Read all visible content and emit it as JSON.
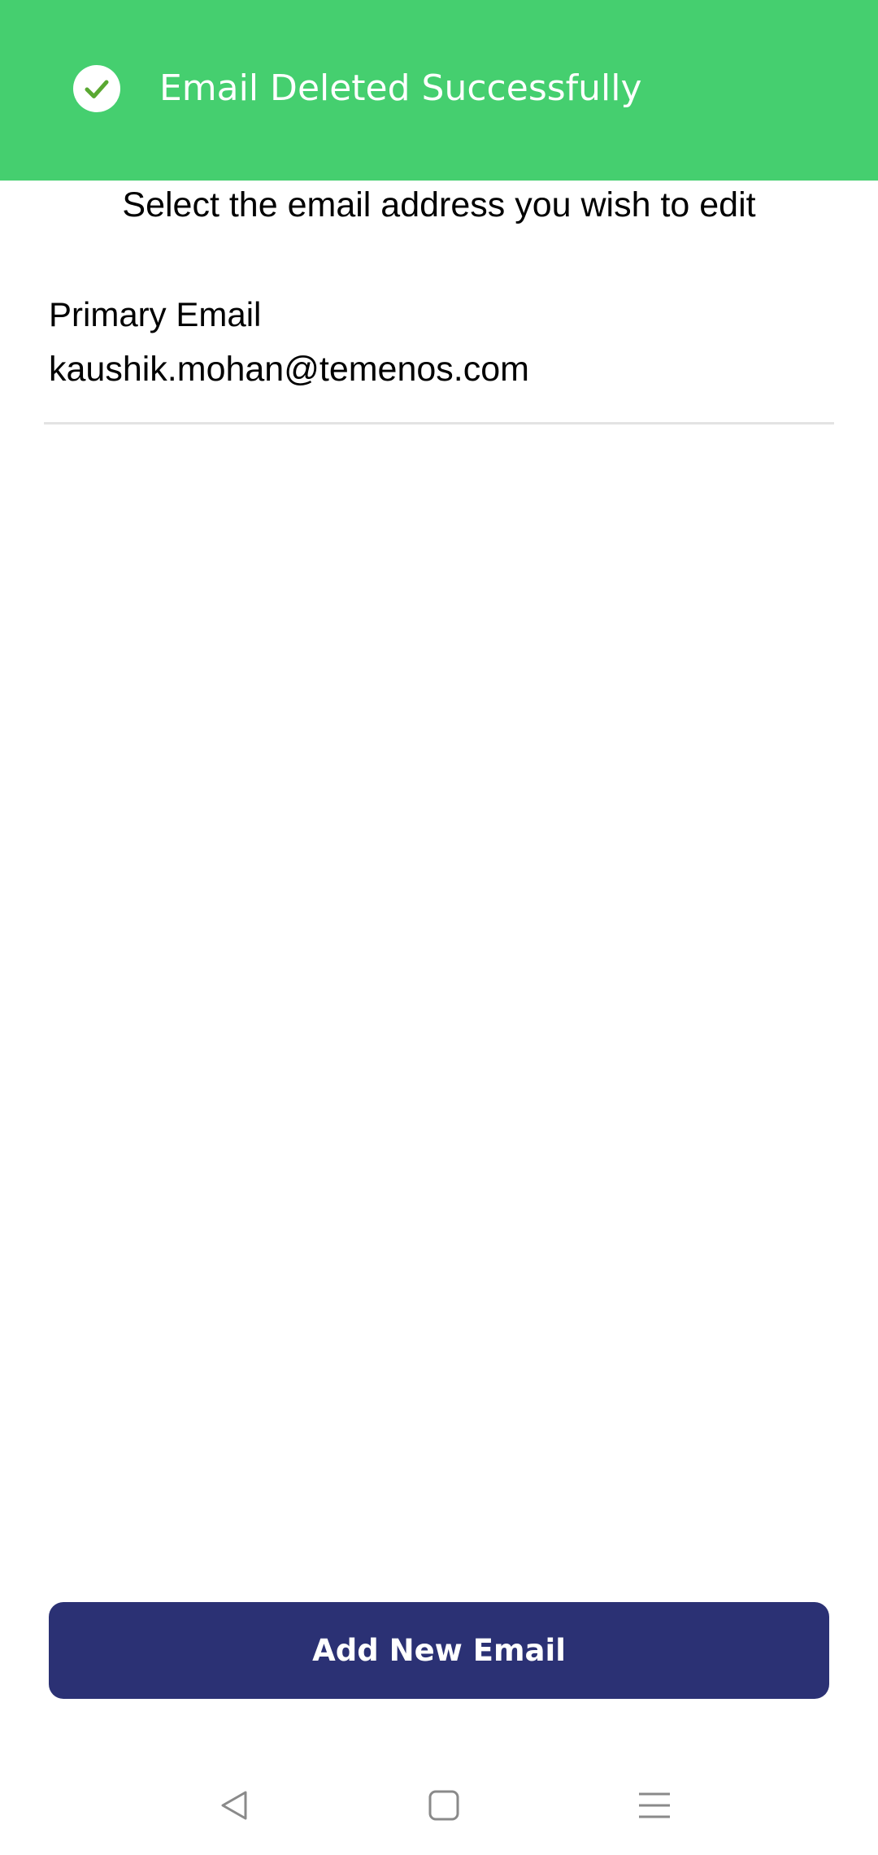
{
  "toast": {
    "message": "Email Deleted Successfully",
    "icon": "check-circle-icon",
    "background_color": "#45cf6f",
    "icon_check_color": "#5aa832"
  },
  "instruction": "Select the email address you wish to edit",
  "emails": [
    {
      "label": "Primary Email",
      "address": "kaushik.mohan@temenos.com"
    }
  ],
  "add_button": {
    "label": "Add New Email",
    "color": "#2b3174"
  },
  "navbar": {
    "back_icon": "back-triangle-icon",
    "home_icon": "home-square-icon",
    "menu_icon": "menu-lines-icon"
  }
}
